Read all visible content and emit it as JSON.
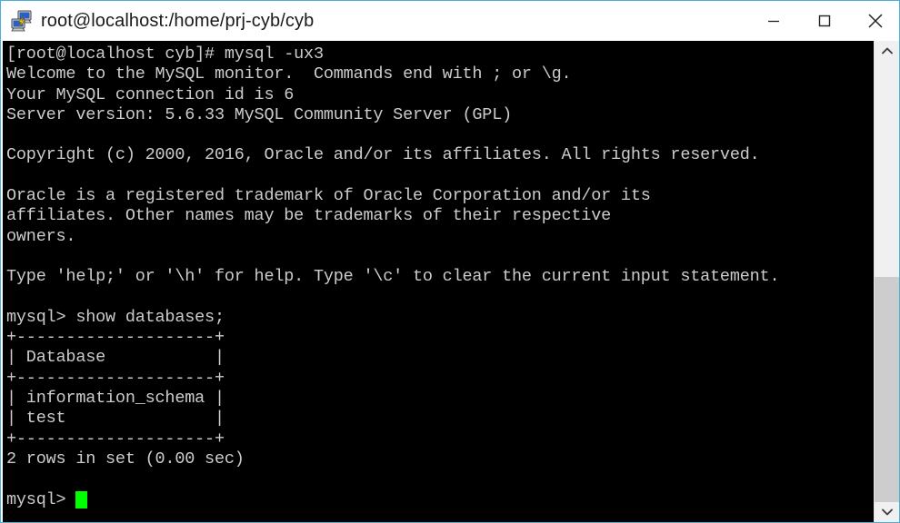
{
  "window": {
    "title": "root@localhost:/home/prj-cyb/cyb",
    "icon": "putty-terminal-icon",
    "accent_border_color": "#4ab0d8",
    "titlebar_bg": "#ffffff",
    "titlebar_fg": "#1a1a1a"
  },
  "window_controls": {
    "minimize_label": "Minimize",
    "maximize_label": "Maximize",
    "close_label": "Close"
  },
  "terminal": {
    "background_color": "#000000",
    "foreground_color": "#cccccc",
    "cursor_color": "#00ff00",
    "lines": [
      "[root@localhost cyb]# mysql -ux3",
      "Welcome to the MySQL monitor.  Commands end with ; or \\g.",
      "Your MySQL connection id is 6",
      "Server version: 5.6.33 MySQL Community Server (GPL)",
      "",
      "Copyright (c) 2000, 2016, Oracle and/or its affiliates. All rights reserved.",
      "",
      "Oracle is a registered trademark of Oracle Corporation and/or its",
      "affiliates. Other names may be trademarks of their respective",
      "owners.",
      "",
      "Type 'help;' or '\\h' for help. Type '\\c' to clear the current input statement.",
      "",
      "mysql> show databases;",
      "+--------------------+",
      "| Database           |",
      "+--------------------+",
      "| information_schema |",
      "| test               |",
      "+--------------------+",
      "2 rows in set (0.00 sec)",
      ""
    ],
    "prompt": "mysql> ",
    "cursor": "block"
  },
  "query_result": {
    "command": "show databases;",
    "columns": [
      "Database"
    ],
    "rows": [
      [
        "information_schema"
      ],
      [
        "test"
      ]
    ],
    "status": "2 rows in set (0.00 sec)"
  },
  "scrollbar": {
    "up_arrow": "chevron-up-icon",
    "down_arrow": "chevron-down-icon",
    "thumb_top_pct": 49,
    "thumb_height_pct": 51,
    "track_color": "#f0f0f0",
    "thumb_color": "#cdcdcd"
  }
}
